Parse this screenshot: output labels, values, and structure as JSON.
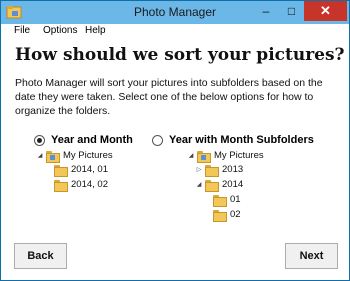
{
  "window": {
    "title": "Photo Manager"
  },
  "menu": [
    "File",
    "Options",
    "Help"
  ],
  "heading": "How should we sort your pictures?",
  "description": "Photo Manager will sort your pictures into subfolders based on the date they were taken.  Select one of the below options for how to organize the folders.",
  "options": [
    {
      "label": "Year and Month",
      "selected": true,
      "tree": [
        {
          "label": "My Pictures",
          "expanded": true,
          "depth": 0
        },
        {
          "label": "2014, 01",
          "depth": 1
        },
        {
          "label": "2014, 02",
          "depth": 1
        }
      ]
    },
    {
      "label": "Year with Month Subfolders",
      "selected": false,
      "tree": [
        {
          "label": "My Pictures",
          "expanded": true,
          "depth": 0
        },
        {
          "label": "2013",
          "expanded": false,
          "depth": 1
        },
        {
          "label": "2014",
          "expanded": true,
          "depth": 1
        },
        {
          "label": "01",
          "depth": 2
        },
        {
          "label": "02",
          "depth": 2
        }
      ]
    }
  ],
  "buttons": {
    "back": "Back",
    "next": "Next"
  },
  "colors": {
    "titlebar": "#6bb7e8",
    "close": "#c7342a",
    "folder": "#f3c65a"
  }
}
